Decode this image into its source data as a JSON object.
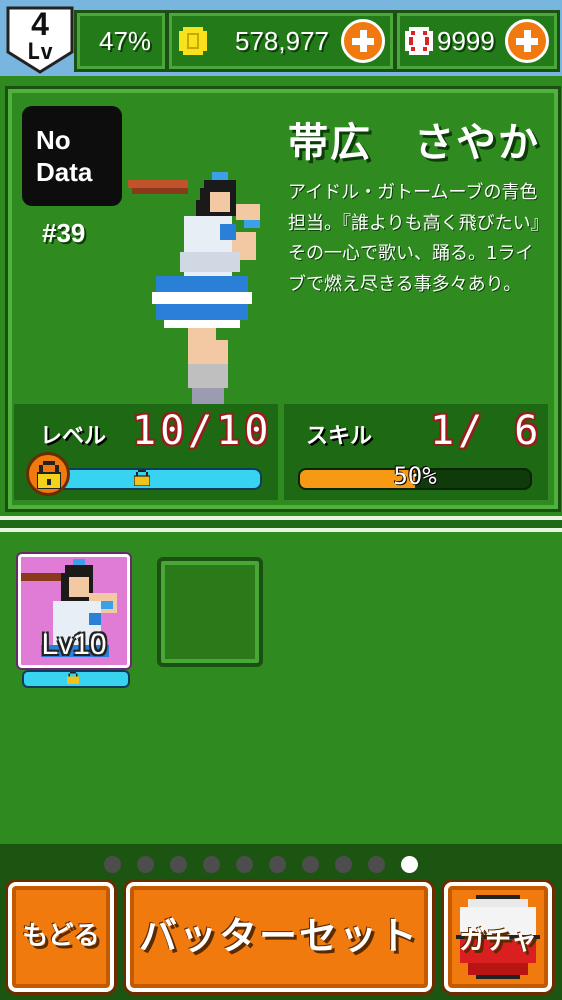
{
  "header": {
    "player_level_number": "4",
    "player_level_label": "Lv",
    "exp_percent": "47%",
    "coins": "578,977",
    "balls": "9999"
  },
  "character": {
    "no_data_label": "No\nData",
    "number": "#39",
    "name": "帯広　さやか",
    "description": "アイドル・ガトームーブの青色担当。『誰よりも高く飛びたい』その一心で歌い、踊る。1ライブで燃え尽きる事多々あり。",
    "level_label": "レベル",
    "level_value": "10/10",
    "level_progress": 1.0,
    "skill_label": "スキル",
    "skill_value": "1/ 6",
    "skill_percent": "50%",
    "skill_progress": 0.5
  },
  "cards": [
    {
      "level_label": "Lv10",
      "progress": 1.0,
      "locked": true
    }
  ],
  "pager": {
    "total": 10,
    "active": 9
  },
  "buttons": {
    "back": "もどる",
    "batter_set": "バッターセット",
    "gacha": "ガチャ"
  },
  "colors": {
    "panel_green": "#2f8b20",
    "accent_orange": "#f07a0e",
    "bar_cyan": "#39d3f2",
    "skill_bar_orange": "#f59a12"
  }
}
